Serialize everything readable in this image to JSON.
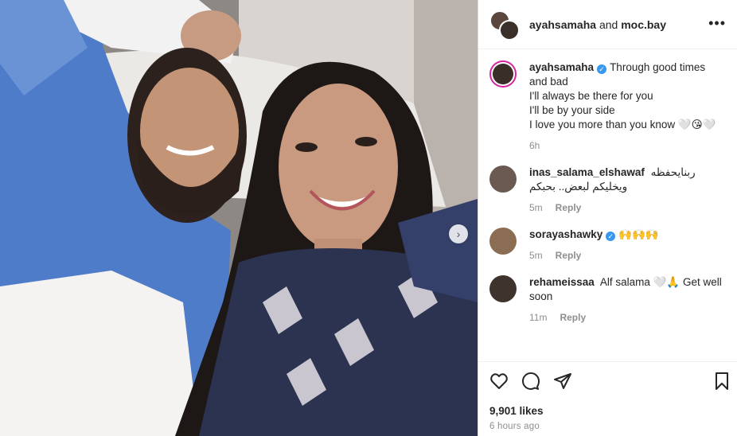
{
  "post": {
    "header_user": "ayahsamaha",
    "header_and": " and ",
    "header_collab": "moc.bay",
    "more": "•••"
  },
  "caption": {
    "username": "ayahsamaha",
    "verified": "✓",
    "lines": [
      "Through good times",
      "and bad",
      "I'll always be there for you",
      "I'll be by your side",
      "I love you more than you know 🤍😘🤍"
    ],
    "time": "6h"
  },
  "comments": [
    {
      "username": "inas_salama_elshawaf",
      "text": "ربنايحفظه ويخليكم لبعض.. بحبكم",
      "time": "5m",
      "reply": "Reply"
    },
    {
      "username": "sorayashawky",
      "text": "🙌🙌🙌",
      "time": "5m",
      "reply": "Reply"
    },
    {
      "username": "rehameissaa",
      "text": "Alf salama 🤍🙏 Get well soon",
      "time": "11m",
      "reply": "Reply"
    }
  ],
  "actions": {
    "likes": "9,901 likes",
    "timestamp": "6 hours ago"
  },
  "colors": {
    "verified": "#3897f0",
    "story_ring": "#d6249f",
    "meta_grey": "#8e8e8e"
  },
  "icons": [
    "heart-icon",
    "comment-icon",
    "share-icon",
    "bookmark-icon",
    "next-arrow-icon"
  ]
}
